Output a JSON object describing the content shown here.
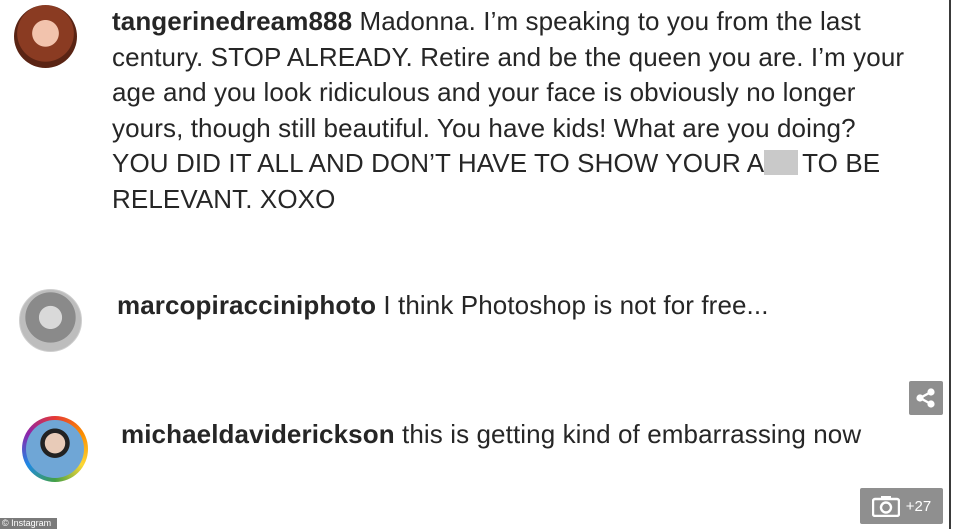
{
  "comments": [
    {
      "username": "tangerinedream888",
      "text_before_redaction": " Madonna. I’m speaking to you from the last century. STOP ALREADY. Retire and be the queen you are. I’m your age and you look ridiculous and your face is obviously no longer yours, though still beautiful. You have kids! What are you doing? YOU DID IT ALL AND DON’T HAVE TO SHOW YOUR A",
      "text_after_redaction": "TO BE RELEVANT. XOXO"
    },
    {
      "username": "marcopiracciniphoto",
      "text": " I think Photoshop is not for free..."
    },
    {
      "username": "michaeldaviderickson",
      "text": " this is getting kind of embarrassing now"
    }
  ],
  "overlay": {
    "share_icon": "share-icon",
    "gallery_icon": "camera-icon",
    "gallery_count": "+27",
    "credit": "© Instagram"
  }
}
